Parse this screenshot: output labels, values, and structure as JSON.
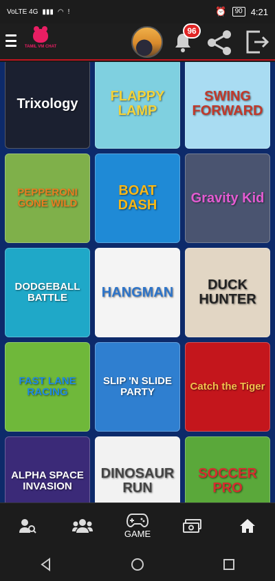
{
  "status": {
    "carrier": "VoLTE 4G",
    "time": "4:21",
    "battery": "90"
  },
  "header": {
    "logo_text": "TAMIL VM CHAT",
    "notification_count": "96"
  },
  "games": [
    {
      "title": "Trixology",
      "bg": "#1b2030",
      "fg": "#ffffff"
    },
    {
      "title": "FLAPPY LAMP",
      "bg": "#7fd0e0",
      "fg": "#f2d23a"
    },
    {
      "title": "SWING FORWARD",
      "bg": "#a9dcf2",
      "fg": "#c0392b"
    },
    {
      "title": "PEPPERONI GONE WILD",
      "bg": "#7fb04a",
      "fg": "#e67e22"
    },
    {
      "title": "BOAT DASH",
      "bg": "#1f8ad6",
      "fg": "#f7b718"
    },
    {
      "title": "Gravity Kid",
      "bg": "#4a5470",
      "fg": "#e35bd1"
    },
    {
      "title": "DODGEBALL BATTLE",
      "bg": "#1fa8c8",
      "fg": "#ffffff"
    },
    {
      "title": "HANGMAN",
      "bg": "#f4f4f4",
      "fg": "#2d74c9"
    },
    {
      "title": "DUCK HUNTER",
      "bg": "#e2d6c4",
      "fg": "#222222"
    },
    {
      "title": "FAST LANE RACING",
      "bg": "#6fb83a",
      "fg": "#1e88e5"
    },
    {
      "title": "SLIP 'N SLIDE PARTY",
      "bg": "#2f7fd0",
      "fg": "#ffffff"
    },
    {
      "title": "Catch the Tiger",
      "bg": "#c4161c",
      "fg": "#f2c14e"
    },
    {
      "title": "ALPHA SPACE INVASION",
      "bg": "#3b2a78",
      "fg": "#ffffff"
    },
    {
      "title": "DINOSAUR RUN",
      "bg": "#f2f2f2",
      "fg": "#444444"
    },
    {
      "title": "SOCCER PRO",
      "bg": "#5aa83a",
      "fg": "#d32f2f"
    }
  ],
  "bottom_nav": {
    "game_label": "GAME"
  }
}
